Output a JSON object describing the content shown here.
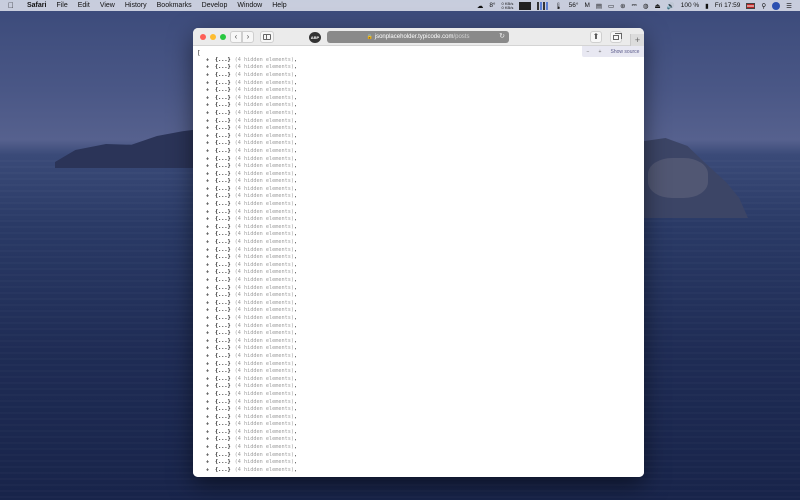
{
  "menubar": {
    "app_name": "Safari",
    "items": [
      "File",
      "Edit",
      "View",
      "History",
      "Bookmarks",
      "Develop",
      "Window",
      "Help"
    ],
    "status": {
      "temperature": "8°",
      "network_up": "0 KB/s",
      "network_down": "0 KB/s",
      "cpu_temp": "56°",
      "battery": "100 %",
      "clock": "Fri 17:59"
    }
  },
  "browser": {
    "url_host": "jsonplaceholder.typicode.com",
    "url_path": "/posts",
    "ext_icon_label": "ABP",
    "new_tab_label": "+",
    "source_bar": {
      "minus": "−",
      "plus": "+",
      "show_source": "Show source"
    },
    "json": {
      "open_bracket": "[",
      "toggle": "+",
      "object_label": "{...}",
      "hidden_label": "(4 hidden elements)",
      "comma": ",",
      "rows": 55
    }
  },
  "icons": {
    "apple": "apple-icon",
    "back": "chevron-left-icon",
    "forward": "chevron-right-icon",
    "sidebar": "sidebar-icon",
    "lock": "lock-icon",
    "reload": "reload-icon",
    "share": "share-icon",
    "tabs": "tabs-overview-icon"
  }
}
